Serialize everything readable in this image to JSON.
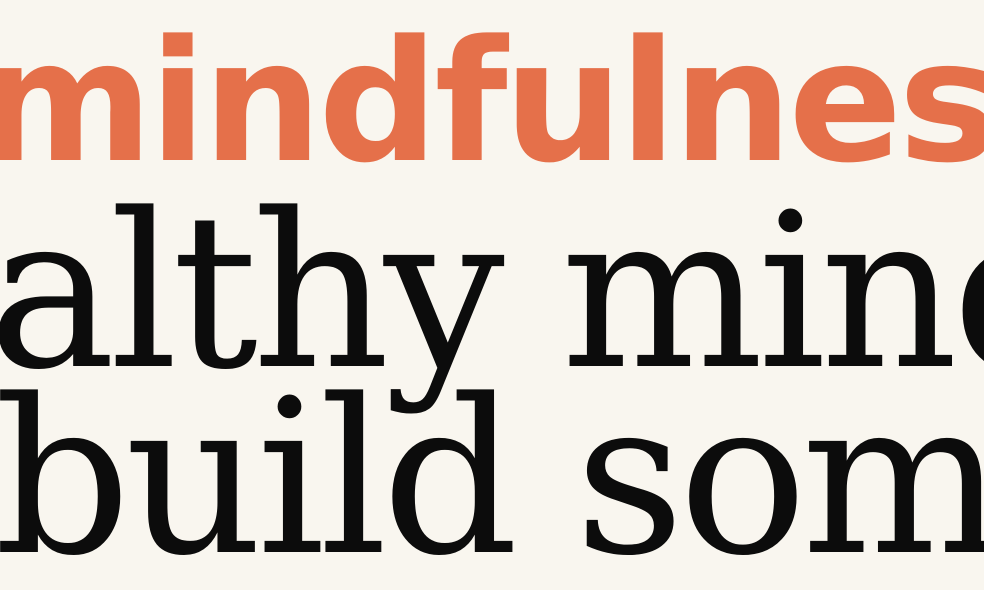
{
  "colors": {
    "background": "#f9f6ef",
    "accent": "#e5704a",
    "text": "#0c0c0c"
  },
  "heading": "mindfulness",
  "lines": [
    "althy mind. O",
    "build someth"
  ]
}
